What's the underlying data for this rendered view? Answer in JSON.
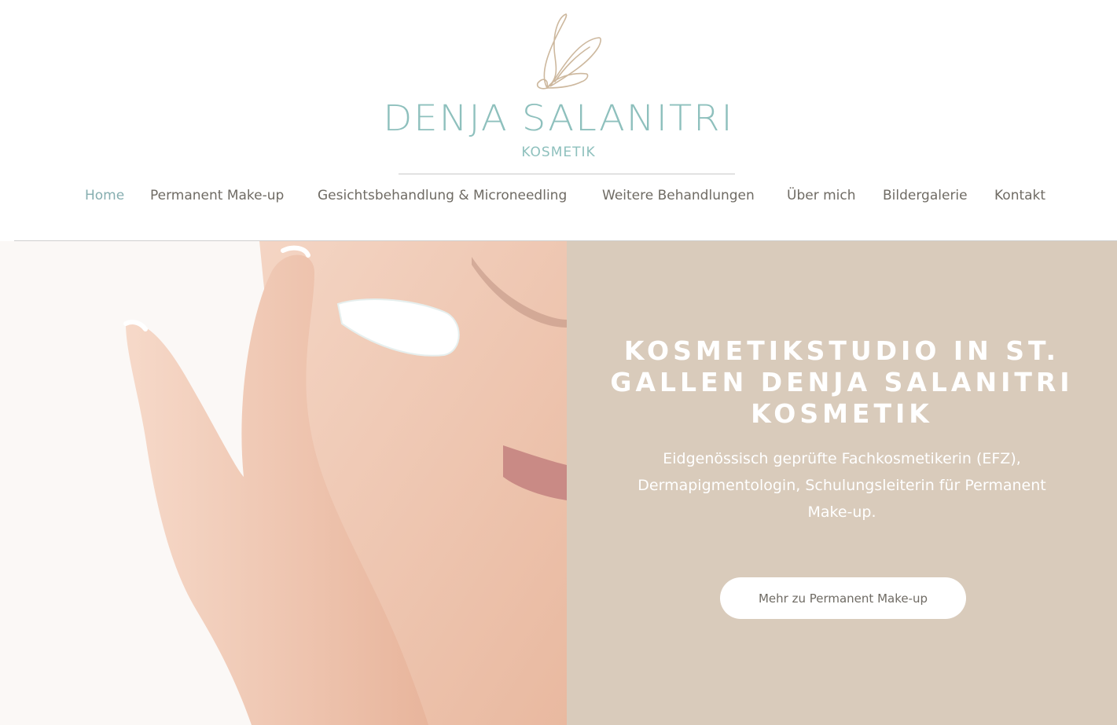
{
  "brand": {
    "name": "DENJA SALANITRI",
    "subtitle": "KOSMETIK",
    "logo_icon": "butterfly-icon",
    "color": "#8ec0bd"
  },
  "nav": {
    "items": [
      {
        "label": "Home",
        "active": true
      },
      {
        "label": "Permanent Make-up",
        "active": false
      },
      {
        "label": "Gesichtsbehandlung & Microneedling",
        "active": false
      },
      {
        "label": "Weitere Behandlungen",
        "active": false
      },
      {
        "label": "Über mich",
        "active": false
      },
      {
        "label": "Bildergalerie",
        "active": false
      },
      {
        "label": "Kontakt",
        "active": false
      }
    ],
    "active_color": "#86aeb0",
    "color": "#6f6b64"
  },
  "hero": {
    "title": "KOSMETIKSTUDIO IN ST. GALLEN DENJA SALANITRI KOSMETIK",
    "text": "Eidgenössisch geprüfte Fachkosmetikerin (EFZ), Dermapigmentologin, Schulungsleiterin für Permanent Make-up.",
    "button_label": "Mehr zu Permanent Make-up",
    "panel_color": "#d9cbbb",
    "image": "woman-applying-face-cream-photo"
  }
}
